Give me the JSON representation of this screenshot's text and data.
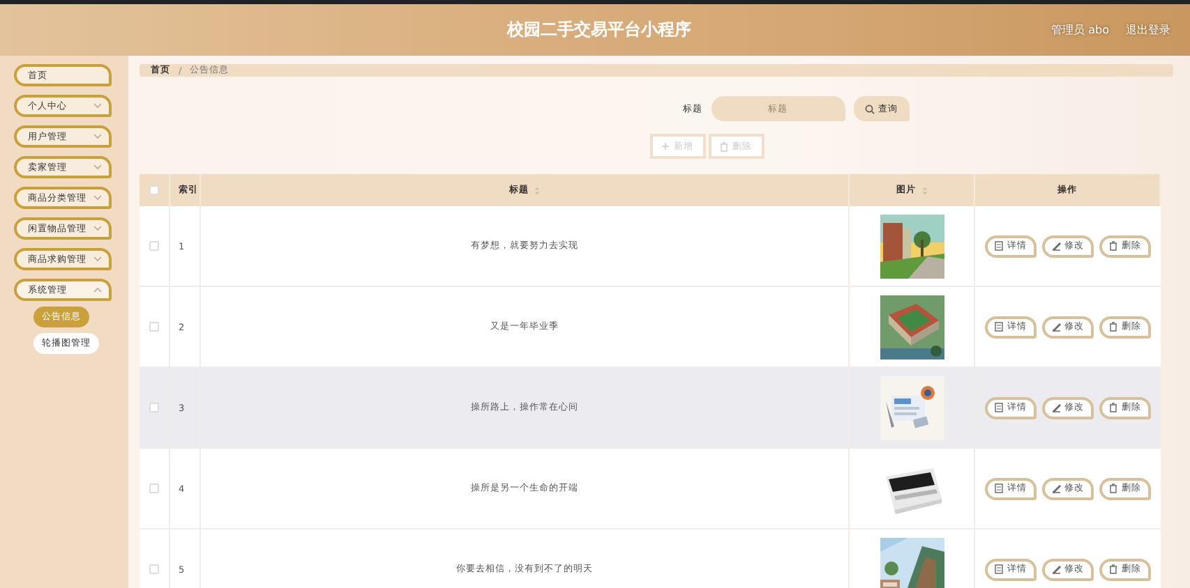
{
  "header": {
    "title": "校园二手交易平台小程序",
    "user": "管理员 abo",
    "logout": "退出登录"
  },
  "sidebar": {
    "items": [
      {
        "label": "首页",
        "expandable": false,
        "expanded": false
      },
      {
        "label": "个人中心",
        "expandable": true,
        "expanded": false
      },
      {
        "label": "用户管理",
        "expandable": true,
        "expanded": false
      },
      {
        "label": "卖家管理",
        "expandable": true,
        "expanded": false
      },
      {
        "label": "商品分类管理",
        "expandable": true,
        "expanded": false
      },
      {
        "label": "闲置物品管理",
        "expandable": true,
        "expanded": false
      },
      {
        "label": "商品求购管理",
        "expandable": true,
        "expanded": false
      },
      {
        "label": "系统管理",
        "expandable": true,
        "expanded": true,
        "children": [
          {
            "label": "公告信息",
            "selected": true
          },
          {
            "label": "轮播图管理",
            "selected": false
          }
        ]
      }
    ]
  },
  "breadcrumb": [
    "首页",
    "/",
    "公告信息"
  ],
  "search": {
    "label": "标题",
    "placeholder": "标题",
    "button": "查询"
  },
  "toolbar": {
    "add": "新增",
    "delete": "删除"
  },
  "table": {
    "select_all": false,
    "columns": [
      {
        "label": "索引",
        "sortable": false
      },
      {
        "label": "标题",
        "sortable": true
      },
      {
        "label": "图片",
        "sortable": true
      },
      {
        "label": "操作",
        "sortable": false
      }
    ],
    "rows": [
      {
        "checked": false,
        "hovered": false,
        "index": "1",
        "title": "有梦想，就要努力去实现",
        "image": {
          "kind": "picture"
        },
        "actions": [
          "详情",
          "修改",
          "删除"
        ]
      },
      {
        "checked": false,
        "hovered": false,
        "index": "2",
        "title": "又是一年毕业季",
        "image": {
          "kind": "picture"
        },
        "actions": [
          "详情",
          "修改",
          "删除"
        ]
      },
      {
        "checked": false,
        "hovered": true,
        "index": "3",
        "title": "操所路上，操作常在心间",
        "image": {
          "kind": "picture"
        },
        "actions": [
          "详情",
          "修改",
          "删除"
        ]
      },
      {
        "checked": false,
        "hovered": false,
        "index": "4",
        "title": "操所是另一个生命的开端",
        "image": {
          "kind": "picture"
        },
        "actions": [
          "详情",
          "修改",
          "删除"
        ]
      },
      {
        "checked": false,
        "hovered": false,
        "index": "5",
        "title": "你要去相信，没有到不了的明天",
        "image": {
          "kind": "picture"
        },
        "actions": [
          "详情",
          "修改",
          "删除"
        ]
      }
    ]
  }
}
